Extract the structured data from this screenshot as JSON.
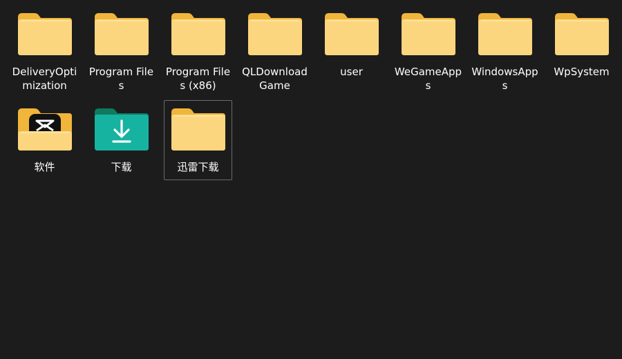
{
  "folders": [
    {
      "label": "DeliveryOptimization",
      "icon": "folder-icon"
    },
    {
      "label": "Program Files",
      "icon": "folder-icon"
    },
    {
      "label": "Program Files (x86)",
      "icon": "folder-icon"
    },
    {
      "label": "QLDownloadGame",
      "icon": "folder-icon"
    },
    {
      "label": "user",
      "icon": "folder-icon"
    },
    {
      "label": "WeGameApps",
      "icon": "folder-icon"
    },
    {
      "label": "WindowsApps",
      "icon": "folder-icon"
    },
    {
      "label": "WpSystem",
      "icon": "folder-icon"
    },
    {
      "label": "软件",
      "icon": "folder-with-app-icon"
    },
    {
      "label": "下载",
      "icon": "downloads-folder-icon"
    },
    {
      "label": "迅雷下载",
      "icon": "folder-icon",
      "selected": true
    }
  ],
  "colors": {
    "background": "#1c1c1c",
    "folder_back": "#f0b53a",
    "folder_front": "#fcd67e",
    "downloads_back": "#0f7a5f",
    "downloads_front": "#17b3a1"
  }
}
